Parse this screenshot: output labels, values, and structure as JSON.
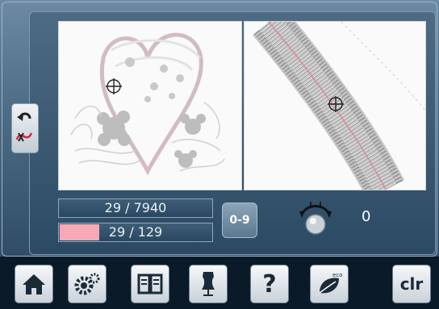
{
  "counters": {
    "stitch": "29 / 7940",
    "color": "29 / 129",
    "color_progress_fraction": 0.26
  },
  "controls": {
    "number_button_label": "0-9",
    "knob_value": "0"
  },
  "taskbar": {
    "items": [
      {
        "icon": "home-icon"
      },
      {
        "icon": "settings-icon"
      },
      {
        "icon": "manual-icon"
      },
      {
        "icon": "dress-form-icon"
      },
      {
        "icon": "help-icon",
        "label": "?"
      },
      {
        "icon": "eco-icon",
        "label": "eco"
      },
      {
        "icon": "clear-icon",
        "label": "clr"
      }
    ]
  },
  "colors": {
    "progress_fill": "#f4a9b4",
    "screen_bg": "#4f6e88",
    "taskbar_bg": "#0a1a29"
  }
}
